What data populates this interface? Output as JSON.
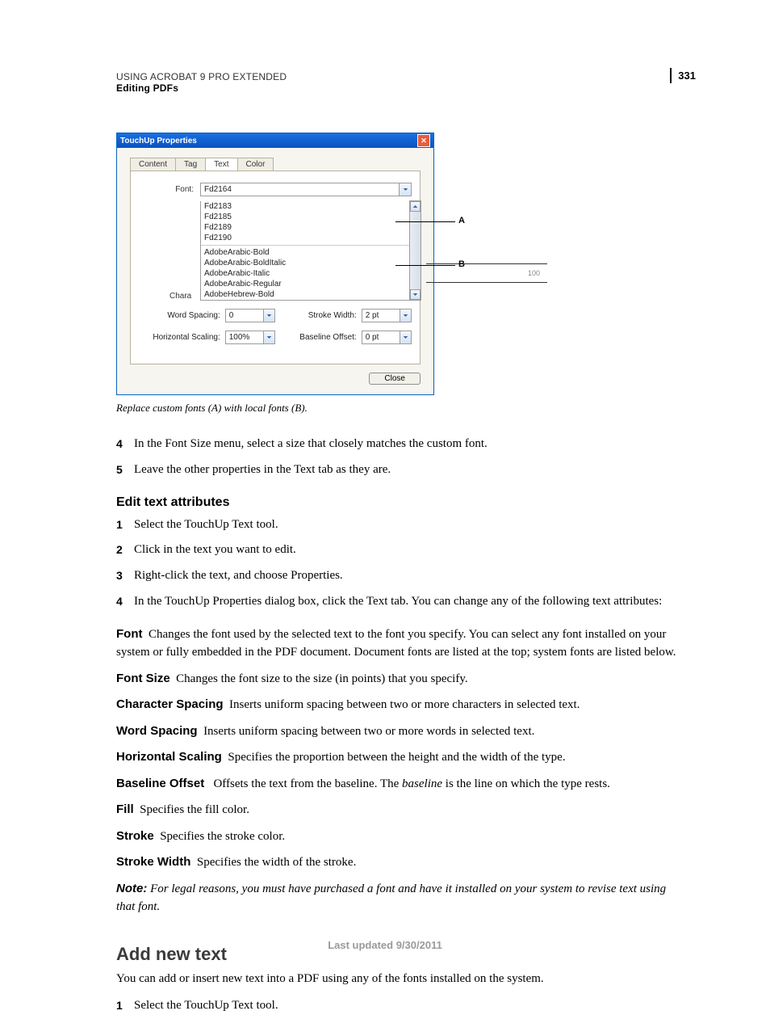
{
  "page": {
    "number": "331",
    "header_line1": "USING ACROBAT 9 PRO EXTENDED",
    "header_line2": "Editing PDFs",
    "footer": "Last updated 9/30/2011"
  },
  "dialog": {
    "title": "TouchUp Properties",
    "close_icon": "✕",
    "tabs": [
      "Content",
      "Tag",
      "Text",
      "Color"
    ],
    "active_tab_index": 2,
    "font_label": "Font:",
    "font_value": "Fd2164",
    "font_list_custom": [
      "Fd2183",
      "Fd2185",
      "Fd2189",
      "Fd2190"
    ],
    "font_list_local": [
      "AdobeArabic-Bold",
      "AdobeArabic-BoldItalic",
      "AdobeArabic-Italic",
      "AdobeArabic-Regular",
      "AdobeHebrew-Bold"
    ],
    "char_stub": "Chara",
    "hidden_100": "100",
    "ws_label": "Word Spacing:",
    "ws_value": "0",
    "sw_label": "Stroke Width:",
    "sw_value": "2 pt",
    "hs_label": "Horizontal Scaling:",
    "hs_value": "100%",
    "bo_label": "Baseline Offset:",
    "bo_value": "0 pt",
    "close_btn": "Close"
  },
  "callouts": {
    "A": "A",
    "B": "B"
  },
  "caption": "Replace custom fonts (A) with local fonts (B).",
  "steps_cont": [
    "In the Font Size menu, select a size that closely matches the custom font.",
    "Leave the other properties in the Text tab as they are."
  ],
  "section1": {
    "heading": "Edit text attributes",
    "steps": [
      "Select the TouchUp Text tool.",
      "Click in the text you want to edit.",
      "Right-click the text, and choose Properties.",
      "In the TouchUp Properties dialog box, click the Text tab. You can change any of the following text attributes:"
    ],
    "defs": [
      {
        "term": "Font",
        "text": "Changes the font used by the selected text to the font you specify. You can select any font installed on your system or fully embedded in the PDF document. Document fonts are listed at the top; system fonts are listed below."
      },
      {
        "term": "Font Size",
        "text": "Changes the font size to the size (in points) that you specify."
      },
      {
        "term": "Character Spacing",
        "text": "Inserts uniform spacing between two or more characters in selected text."
      },
      {
        "term": "Word Spacing",
        "text": "Inserts uniform spacing between two or more words in selected text."
      },
      {
        "term": "Horizontal Scaling",
        "text": "Specifies the proportion between the height and the width of the type."
      },
      {
        "term": "Baseline Offset",
        "text_before": "Offsets the text from the baseline. The ",
        "ital": "baseline",
        "text_after": " is the line on which the type rests."
      },
      {
        "term": "Fill",
        "text": "Specifies the fill color."
      },
      {
        "term": "Stroke",
        "text": "Specifies the stroke color."
      },
      {
        "term": "Stroke Width",
        "text": "Specifies the width of the stroke."
      }
    ],
    "note_label": "Note:",
    "note_text": "For legal reasons, you must have purchased a font and have it installed on your system to revise text using that font."
  },
  "section2": {
    "heading": "Add new text",
    "intro": "You can add or insert new text into a PDF using any of the fonts installed on the system.",
    "steps": [
      "Select the TouchUp Text tool."
    ]
  }
}
